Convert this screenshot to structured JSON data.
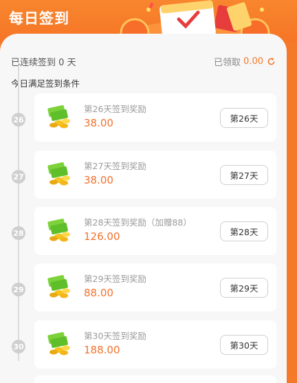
{
  "header": {
    "title": "每日签到"
  },
  "summary": {
    "streak_label": "已连续签到",
    "streak_count": "0",
    "streak_unit": "天",
    "claimed_label": "已领取",
    "claimed_amount": "0.00"
  },
  "condition_text": "今日满足签到条件",
  "days": [
    {
      "day": "26",
      "name": "第26天签到奖励",
      "amount": "38.00",
      "button": "第26天"
    },
    {
      "day": "27",
      "name": "第27天签到奖励",
      "amount": "38.00",
      "button": "第27天"
    },
    {
      "day": "28",
      "name": "第28天签到奖励（加赠88）",
      "amount": "126.00",
      "button": "第28天"
    },
    {
      "day": "29",
      "name": "第29天签到奖励",
      "amount": "88.00",
      "button": "第29天"
    },
    {
      "day": "30",
      "name": "第30天签到奖励",
      "amount": "188.00",
      "button": "第30天"
    }
  ],
  "colors": {
    "brand": "#f47a2a",
    "amount": "#f3702a"
  },
  "icons": {
    "reward": "money-coins-icon",
    "refresh": "refresh-icon",
    "banner": "calendar-check-icon"
  }
}
